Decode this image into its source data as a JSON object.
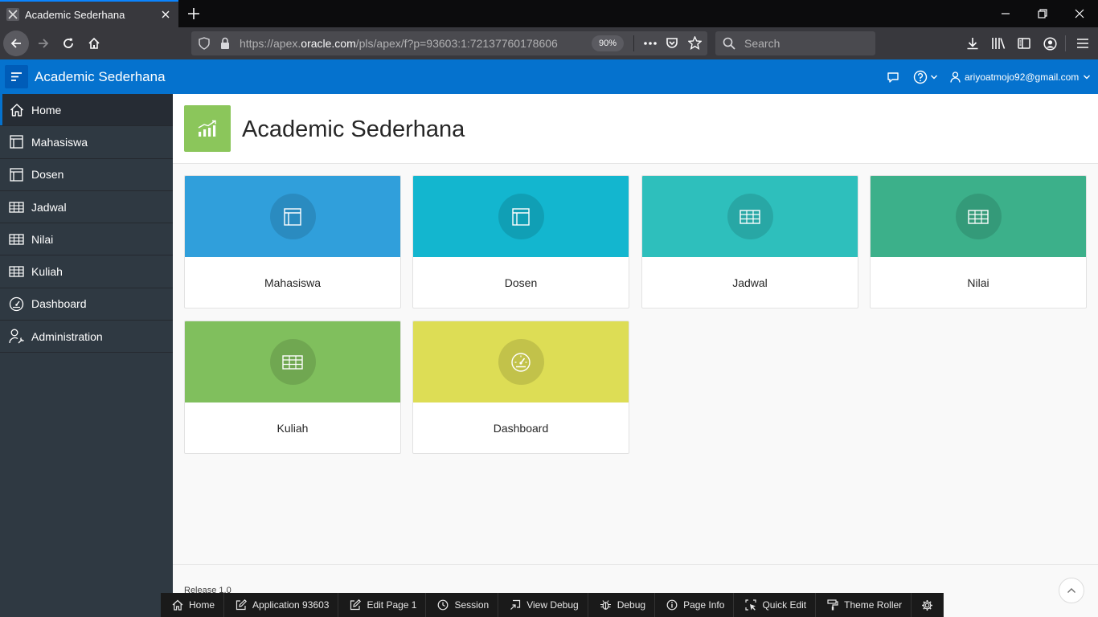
{
  "browser": {
    "tab_title": "Academic Sederhana",
    "url_prefix": "https://apex.",
    "url_host": "oracle.com",
    "url_suffix": "/pls/apex/f?p=93603:1:72137760178606",
    "zoom": "90%",
    "search_placeholder": "Search"
  },
  "header": {
    "app_title": "Academic Sederhana",
    "user": "ariyoatmojo92@gmail.com"
  },
  "sidebar": {
    "items": [
      {
        "label": "Home",
        "icon": "home-icon",
        "active": true
      },
      {
        "label": "Mahasiswa",
        "icon": "layout-icon"
      },
      {
        "label": "Dosen",
        "icon": "layout-icon"
      },
      {
        "label": "Jadwal",
        "icon": "table-icon"
      },
      {
        "label": "Nilai",
        "icon": "table-icon"
      },
      {
        "label": "Kuliah",
        "icon": "table-icon"
      },
      {
        "label": "Dashboard",
        "icon": "gauge-icon"
      },
      {
        "label": "Administration",
        "icon": "user-wrench-icon"
      }
    ]
  },
  "page": {
    "title": "Academic Sederhana",
    "icon": "chart-icon",
    "icon_color": "#8bc65b"
  },
  "cards": [
    {
      "label": "Mahasiswa",
      "icon": "layout-icon",
      "color": "#309fdb"
    },
    {
      "label": "Dosen",
      "icon": "layout-icon",
      "color": "#13b6cf"
    },
    {
      "label": "Jadwal",
      "icon": "table-icon",
      "color": "#2ebfbc"
    },
    {
      "label": "Nilai",
      "icon": "table-icon",
      "color": "#3cb08a"
    },
    {
      "label": "Kuliah",
      "icon": "table-icon",
      "color": "#80bf5d"
    },
    {
      "label": "Dashboard",
      "icon": "gauge-icon",
      "color": "#dddd55"
    }
  ],
  "footer": {
    "release": "Release 1.0"
  },
  "dev_toolbar": {
    "items": [
      {
        "label": "Home",
        "icon": "home-icon"
      },
      {
        "label": "Application 93603",
        "icon": "edit-icon"
      },
      {
        "label": "Edit Page 1",
        "icon": "edit-icon"
      },
      {
        "label": "Session",
        "icon": "clock-icon"
      },
      {
        "label": "View Debug",
        "icon": "view-debug-icon"
      },
      {
        "label": "Debug",
        "icon": "bug-icon"
      },
      {
        "label": "Page Info",
        "icon": "info-icon"
      },
      {
        "label": "Quick Edit",
        "icon": "quick-edit-icon"
      },
      {
        "label": "Theme Roller",
        "icon": "paint-roller-icon"
      }
    ],
    "settings_icon": "gear-icon"
  },
  "colors": {
    "header": "#0572ce",
    "sidebar": "#2f3942",
    "browser_chrome": "#38383d"
  }
}
